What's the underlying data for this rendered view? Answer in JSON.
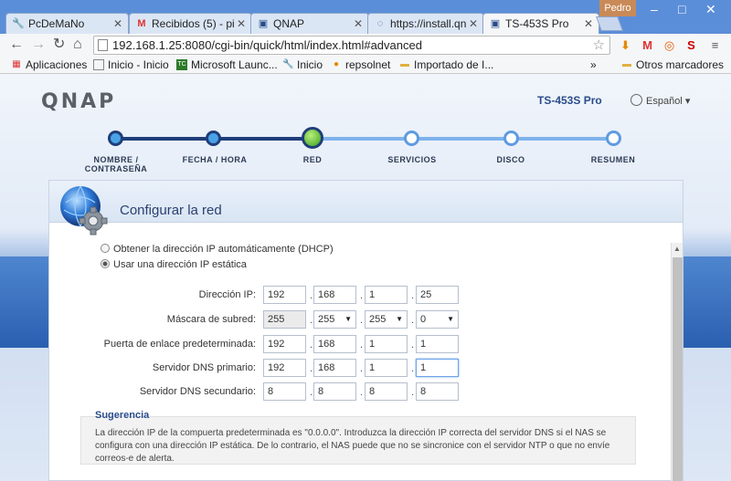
{
  "browser": {
    "tabs": [
      {
        "label": "PcDeMaNo",
        "icon": "wrench-icon"
      },
      {
        "label": "Recibidos (5) - pi",
        "icon": "gmail-icon"
      },
      {
        "label": "QNAP",
        "icon": "qnap-icon"
      },
      {
        "label": "https://install.qn",
        "icon": "loading-icon"
      },
      {
        "label": "TS-453S Pro",
        "icon": "qnap-icon"
      }
    ],
    "user": "Pedro",
    "window_controls": [
      "–",
      "□",
      "✕"
    ],
    "url": "192.168.1.25:8080/cgi-bin/quick/html/index.html#advanced",
    "bookmarks": [
      {
        "label": "Aplicaciones",
        "icon": "apps-icon"
      },
      {
        "label": "Inicio - Inicio",
        "icon": "page-icon"
      },
      {
        "label": "Microsoft Launc...",
        "icon": "tc-icon"
      },
      {
        "label": "Inicio",
        "icon": "wrench-icon"
      },
      {
        "label": "repsolnet",
        "icon": "repsol-icon"
      },
      {
        "label": "Importado de I...",
        "icon": "folder-icon"
      }
    ],
    "more_bookmarks": "»",
    "other_bookmarks": "Otros marcadores"
  },
  "app": {
    "logo": "QNAP",
    "model": "TS-453S Pro",
    "language": "Español"
  },
  "wizard": {
    "steps": [
      {
        "label": "NOMBRE / CONTRASEÑA",
        "state": "done"
      },
      {
        "label": "FECHA / HORA",
        "state": "done"
      },
      {
        "label": "RED",
        "state": "current"
      },
      {
        "label": "SERVICIOS",
        "state": "pending"
      },
      {
        "label": "DISCO",
        "state": "pending"
      },
      {
        "label": "RESUMEN",
        "state": "pending"
      }
    ]
  },
  "panel": {
    "title": "Configurar la red",
    "dhcp_label": "Obtener la dirección IP automáticamente (DHCP)",
    "static_label": "Usar una dirección IP estática",
    "selected_mode": "static",
    "fields": [
      {
        "label": "Dirección IP:",
        "octets": [
          "192",
          "168",
          "1",
          "25"
        ]
      },
      {
        "label": "Máscara de subred:",
        "octets": [
          "255",
          "255",
          "255",
          "0"
        ]
      },
      {
        "label": "Puerta de enlace predeterminada:",
        "octets": [
          "192",
          "168",
          "1",
          "1"
        ]
      },
      {
        "label": "Servidor DNS primario:",
        "octets": [
          "192",
          "168",
          "1",
          "1"
        ]
      },
      {
        "label": "Servidor DNS secundario:",
        "octets": [
          "8",
          "8",
          "8",
          "8"
        ]
      }
    ],
    "hint_title": "Sugerencia",
    "hint_text": "La dirección IP de la compuerta predeterminada es \"0.0.0.0\". Introduzca la dirección IP correcta del servidor DNS si el NAS se configura con una dirección IP estática. De lo contrario, el NAS puede que no se sincronice con el servidor NTP o que no envíe correos-e de alerta."
  },
  "colors": {
    "accent": "#1f3e7a",
    "step_done": "#4aa2e6",
    "step_current": "#3c9e1e",
    "title": "#2b4070"
  }
}
